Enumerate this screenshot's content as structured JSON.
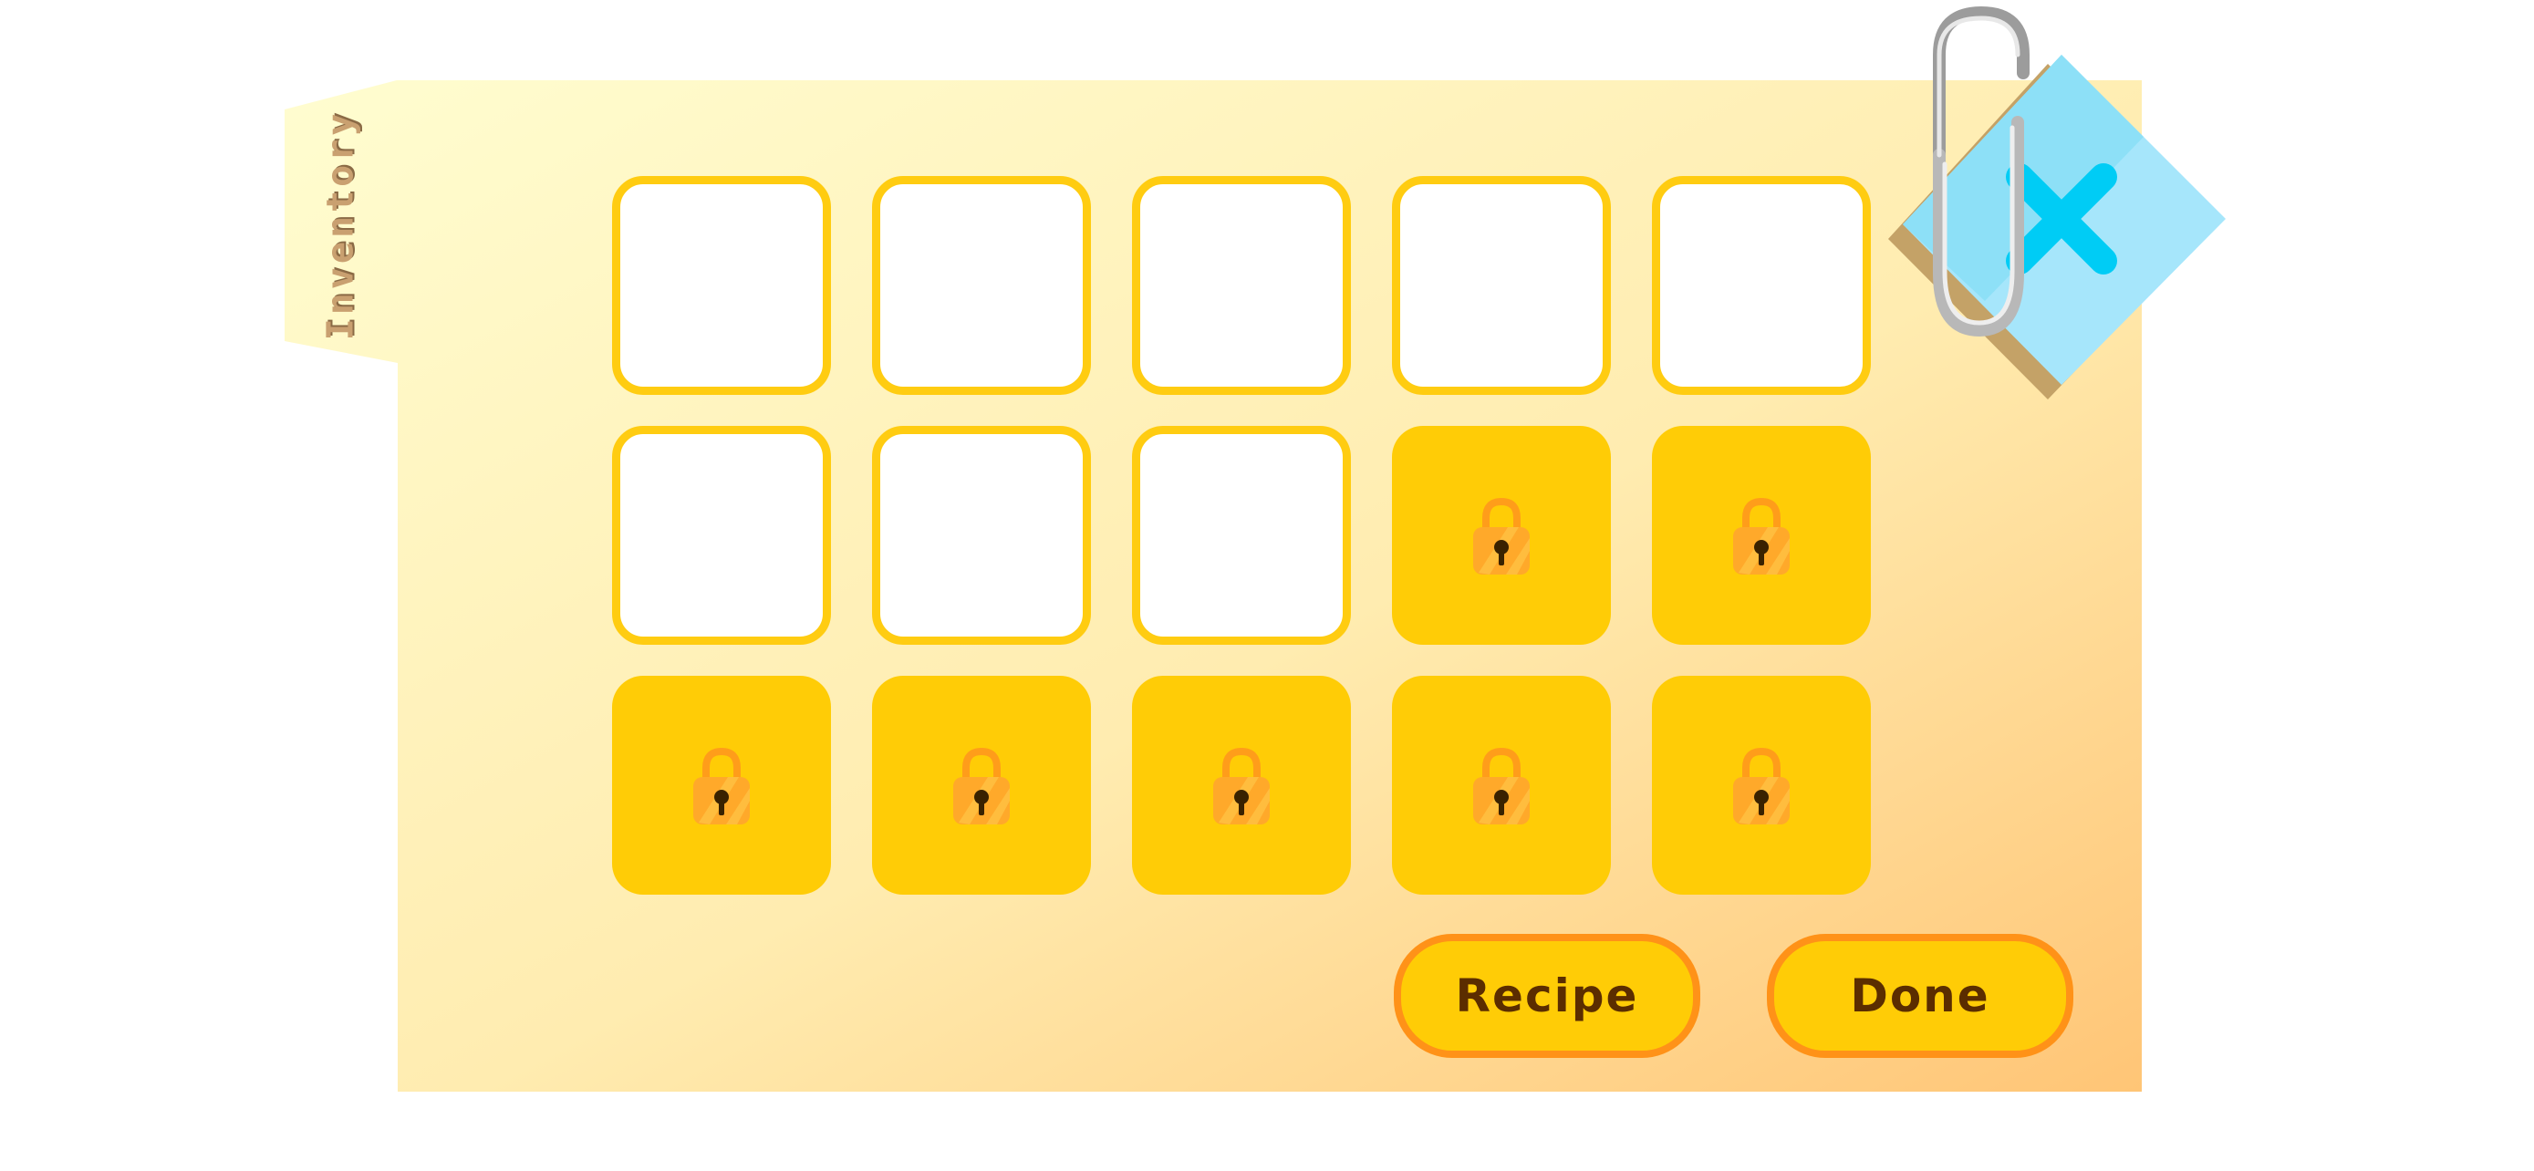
{
  "panel": {
    "tab_label": "Inventory",
    "colors": {
      "panel_top": "#fffccc",
      "panel_bottom": "#ffc778",
      "slot_border": "#ffcc11",
      "locked_fill": "#ffcc06",
      "button_border": "#ff9218",
      "button_text": "#5b2d00"
    }
  },
  "inventory": {
    "rows": 3,
    "columns": 5,
    "slots": [
      {
        "state": "empty"
      },
      {
        "state": "empty"
      },
      {
        "state": "empty"
      },
      {
        "state": "empty"
      },
      {
        "state": "empty"
      },
      {
        "state": "empty"
      },
      {
        "state": "empty"
      },
      {
        "state": "empty"
      },
      {
        "state": "locked",
        "icon": "padlock-icon"
      },
      {
        "state": "locked",
        "icon": "padlock-icon"
      },
      {
        "state": "locked",
        "icon": "padlock-icon"
      },
      {
        "state": "locked",
        "icon": "padlock-icon"
      },
      {
        "state": "locked",
        "icon": "padlock-icon"
      },
      {
        "state": "locked",
        "icon": "padlock-icon"
      },
      {
        "state": "locked",
        "icon": "padlock-icon"
      }
    ]
  },
  "buttons": {
    "recipe_label": "Recipe",
    "done_label": "Done"
  },
  "close": {
    "icon": "close-icon",
    "decoration": "paperclip-icon",
    "color": "#00ccf5"
  }
}
